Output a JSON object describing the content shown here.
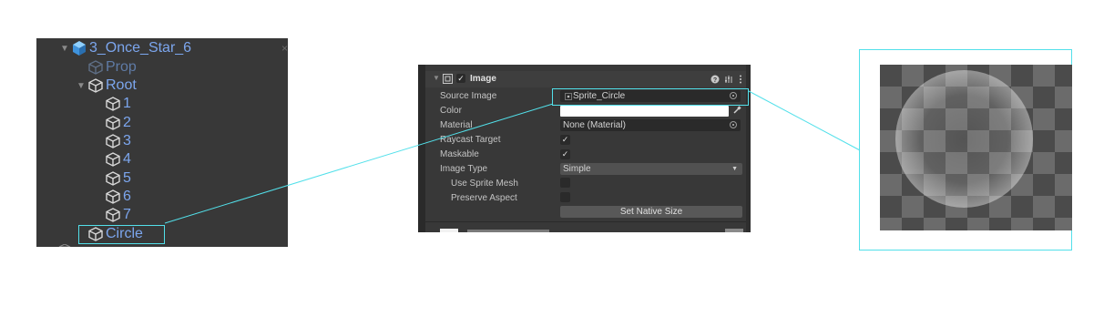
{
  "hierarchy": {
    "rows": [
      {
        "label": "3_Once_Star_6"
      },
      {
        "label": "Prop"
      },
      {
        "label": "Root"
      },
      {
        "label": "1"
      },
      {
        "label": "2"
      },
      {
        "label": "3"
      },
      {
        "label": "4"
      },
      {
        "label": "5"
      },
      {
        "label": "6"
      },
      {
        "label": "7"
      },
      {
        "label": "Circle"
      }
    ],
    "close_glyph": "×"
  },
  "inspector": {
    "component_title": "Image",
    "enabled": true,
    "properties": {
      "source_image_label": "Source Image",
      "source_image_value": "Sprite_Circle",
      "color_label": "Color",
      "material_label": "Material",
      "material_value": "None (Material)",
      "raycast_target_label": "Raycast Target",
      "raycast_target_checked": true,
      "maskable_label": "Maskable",
      "maskable_checked": true,
      "image_type_label": "Image Type",
      "image_type_value": "Simple",
      "use_sprite_mesh_label": "Use Sprite Mesh",
      "preserve_aspect_label": "Preserve Aspect",
      "set_native_size_label": "Set Native Size",
      "check_glyph": "✓"
    }
  },
  "colors": {
    "highlight": "#52e0ea",
    "panel_bg": "#383838",
    "hierarchy_text": "#7ca6ee"
  },
  "preview": {
    "sprite": "circle-sprite"
  }
}
